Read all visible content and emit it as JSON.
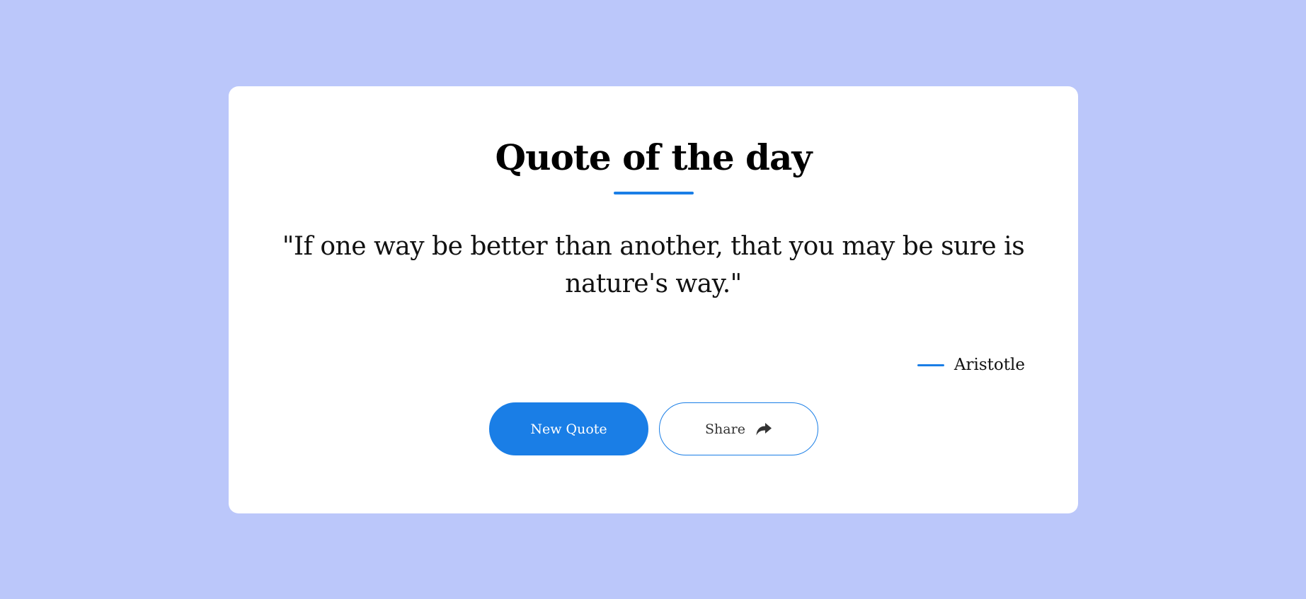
{
  "page": {
    "background_color": "#bbc7fa",
    "card_color": "#ffffff",
    "accent_color": "#1a7ee6"
  },
  "card": {
    "title": "Quote of the day",
    "quote": "\"If one way be better than another, that you may be sure is nature's way.\"",
    "author": "Aristotle"
  },
  "actions": {
    "new_quote_label": "New Quote",
    "share_label": "Share",
    "share_icon": "share-arrow-icon"
  }
}
